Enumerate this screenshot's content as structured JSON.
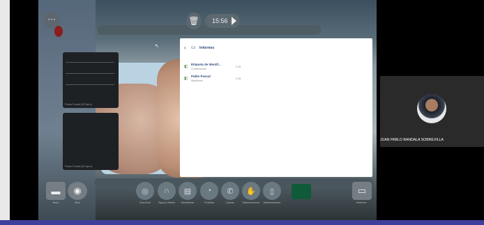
{
  "simulator": {
    "timer": "15:56",
    "panel_top_label": "Pulso Facial (53 bpm)",
    "panel_bottom_label": "Pulso Facial (53 bpm)"
  },
  "dialog": {
    "title": "Informes",
    "items": [
      {
        "title": "Etiqueta de Identif...",
        "subtitle": "Colaboración",
        "time": "0:18"
      },
      {
        "title": "Pablo Pascal",
        "subtitle": "Monitores",
        "time": "0:18"
      }
    ]
  },
  "dock": {
    "left": [
      {
        "icon": "bed-icon",
        "glyph": "▬",
        "label": "Bedo"
      },
      {
        "icon": "eye-icon",
        "glyph": "◉",
        "label": "Mira"
      }
    ],
    "center": [
      {
        "icon": "stethoscope-ring-icon",
        "glyph": "◎",
        "label": "Escuchar"
      },
      {
        "icon": "stethoscope-icon",
        "glyph": "∩",
        "label": "Signos Vitales"
      },
      {
        "icon": "monitor-icon",
        "glyph": "▤",
        "label": "Monitorizar"
      },
      {
        "icon": "gauge-icon",
        "glyph": "◔",
        "label": "Pruebas"
      },
      {
        "icon": "phone-icon",
        "glyph": "✆",
        "label": "Llamar"
      },
      {
        "icon": "hand-icon",
        "glyph": "✋",
        "label": "Intervenciones"
      },
      {
        "icon": "drug-icon",
        "glyph": "▯",
        "label": "Medicamentos"
      }
    ],
    "right": {
      "icon": "folder-icon",
      "glyph": "▭",
      "label": "Informes"
    }
  },
  "participant": {
    "name": "JUAN PABLO BANDALA SOBREVILLA"
  },
  "colors": {
    "accent": "#2c4a78",
    "taskbar": "#3e3f9a"
  }
}
